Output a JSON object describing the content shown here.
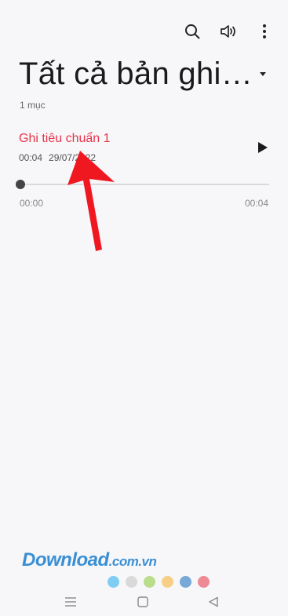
{
  "header": {
    "title": "Tất cả bản ghi…",
    "count_label": "1 mục"
  },
  "toolbar": {
    "search_icon": "search-icon",
    "volume_icon": "volume-icon",
    "more_icon": "more-vert-icon",
    "dropdown_icon": "caret-down-icon"
  },
  "recording": {
    "name": "Ghi tiêu chuẩn 1",
    "duration": "00:04",
    "date": "29/07/2022",
    "position_start": "00:00",
    "position_end": "00:04",
    "progress_fraction": 0
  },
  "watermark": {
    "brand": "Download",
    "domain": ".com.vn"
  },
  "dots_colors": [
    "#7fcdf2",
    "#d9d9d9",
    "#b9dd8a",
    "#f6ce86",
    "#77a8d8",
    "#ee8a93"
  ],
  "navbar": {
    "menu_icon": "menu-icon",
    "home_icon": "square-home-icon",
    "back_icon": "triangle-back-icon"
  },
  "colors": {
    "accent": "#e8344a",
    "arrow": "#f01820",
    "watermark": "#3a8fd4"
  }
}
